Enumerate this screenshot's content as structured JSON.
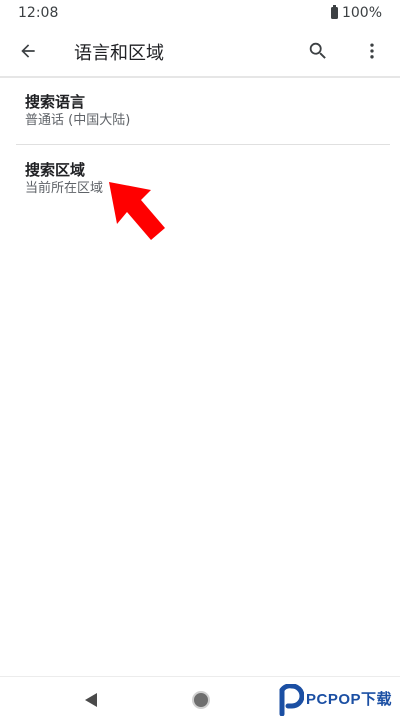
{
  "status_bar": {
    "time": "12:08",
    "battery_text": "100%"
  },
  "app_bar": {
    "title": "语言和区域",
    "back_icon": "arrow-back-icon",
    "search_icon": "search-icon",
    "more_icon": "more-vert-icon"
  },
  "preferences": [
    {
      "title": "搜索语言",
      "summary": "普通话 (中国大陆)"
    },
    {
      "title": "搜索区域",
      "summary": "当前所在区域"
    }
  ],
  "annotation": {
    "icon": "red-arrow-icon",
    "color": "#ff0000"
  },
  "nav_bar": {
    "back_icon": "nav-back-icon",
    "home_icon": "nav-home-icon"
  },
  "watermark": {
    "text": "PCPOP下载",
    "icon": "pcpop-logo-icon"
  },
  "colors": {
    "text_primary": "#202124",
    "text_secondary": "#5f6368",
    "watermark_blue": "#1b4fa3"
  }
}
